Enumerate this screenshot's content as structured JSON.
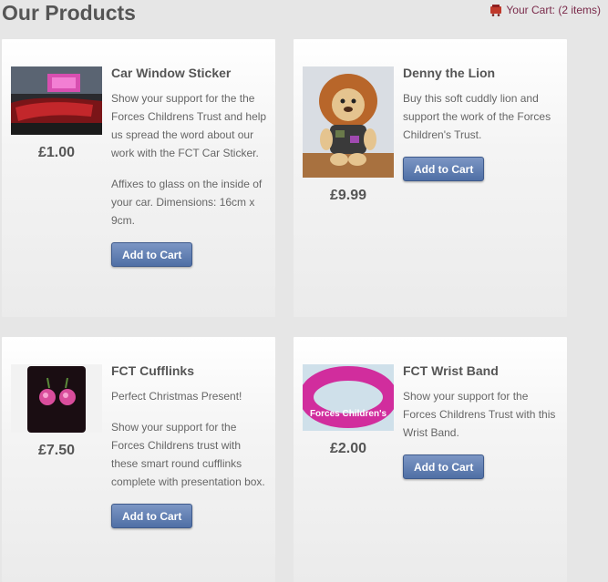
{
  "header": {
    "title": "Our Products",
    "cart_label": "Your Cart: (2 items)",
    "cart_icon": "cart-icon"
  },
  "products": [
    {
      "name": "Car Window Sticker",
      "price": "£1.00",
      "description": [
        "Show your support for the the Forces Childrens Trust and help us spread the word about our work with the FCT Car Sticker.",
        "Affixes to glass on the inside of your car. Dimensions: 16cm x 9cm."
      ],
      "button": "Add to Cart"
    },
    {
      "name": "Denny the Lion",
      "price": "£9.99",
      "description": [
        "Buy this soft cuddly lion and support the work of the Forces Children's Trust."
      ],
      "button": "Add to Cart"
    },
    {
      "name": "FCT Cufflinks",
      "price": "£7.50",
      "description": [
        "Perfect Christmas Present!",
        "Show your support for the Forces Childrens trust with these smart round cufflinks complete with presentation box."
      ],
      "button": "Add to Cart"
    },
    {
      "name": "FCT Wrist Band",
      "price": "£2.00",
      "description": [
        "Show your support for the Forces Childrens Trust with this Wrist Band."
      ],
      "button": "Add to Cart"
    }
  ],
  "images": {
    "wristband_text": "Forces Children's"
  },
  "colors": {
    "button": "#5b79ad",
    "cart_link": "#7a2a4a",
    "text": "#555555"
  }
}
